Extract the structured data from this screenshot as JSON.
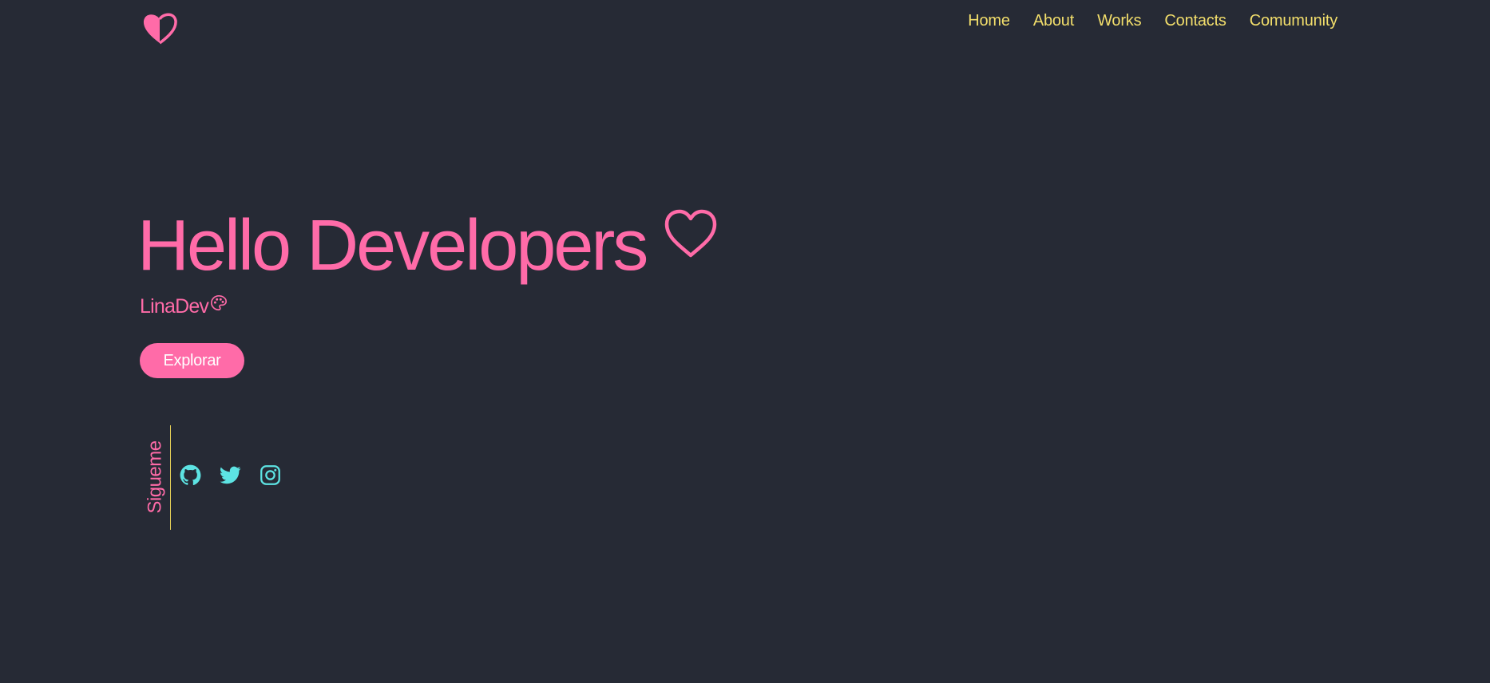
{
  "colors": {
    "background": "#262a35",
    "accent_pink": "#ff6ba8",
    "nav_yellow": "#f2de6b",
    "social_cyan": "#5de3e3",
    "divider_yellow": "#e3cd57"
  },
  "header": {
    "logo_icon": "half-heart-logo-icon",
    "nav": [
      {
        "label": "Home"
      },
      {
        "label": "About"
      },
      {
        "label": "Works"
      },
      {
        "label": "Contacts"
      },
      {
        "label": "Comumunity"
      }
    ]
  },
  "hero": {
    "title": "Hello Developers",
    "title_icon": "heart-outline-icon",
    "subtitle": "LinaDev",
    "subtitle_icon": "palette-icon",
    "cta_label": "Explorar"
  },
  "social": {
    "label": "Sigueme",
    "links": [
      {
        "icon": "github-icon"
      },
      {
        "icon": "twitter-icon"
      },
      {
        "icon": "instagram-icon"
      }
    ]
  }
}
